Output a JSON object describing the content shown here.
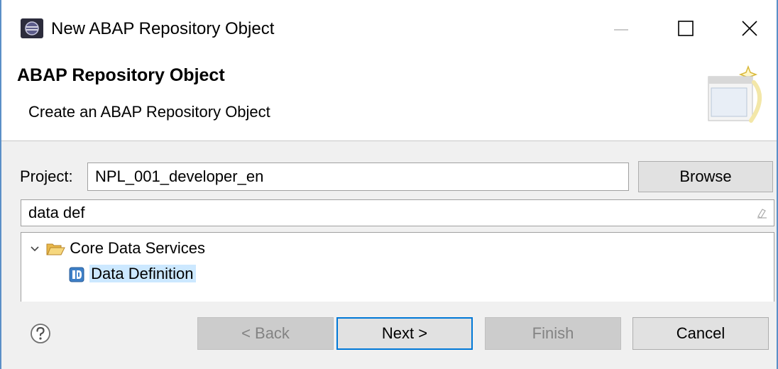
{
  "window": {
    "title": "New ABAP Repository Object"
  },
  "header": {
    "title": "ABAP Repository Object",
    "description": "Create an ABAP Repository Object"
  },
  "project": {
    "label": "Project:",
    "value": "NPL_001_developer_en",
    "browse_label": "Browse"
  },
  "filter": {
    "value": "data def"
  },
  "tree": {
    "items": [
      {
        "label": "Core Data Services",
        "icon": "folder-open-icon",
        "expanded": true
      },
      {
        "label": "Data Definition",
        "icon": "data-definition-icon",
        "selected": true
      }
    ]
  },
  "buttons": {
    "back_label": "< Back",
    "next_label": "Next >",
    "finish_label": "Finish",
    "cancel_label": "Cancel"
  },
  "colors": {
    "accent": "#0078d7",
    "selection": "#cce8ff",
    "window_border": "#5b8fc7"
  }
}
